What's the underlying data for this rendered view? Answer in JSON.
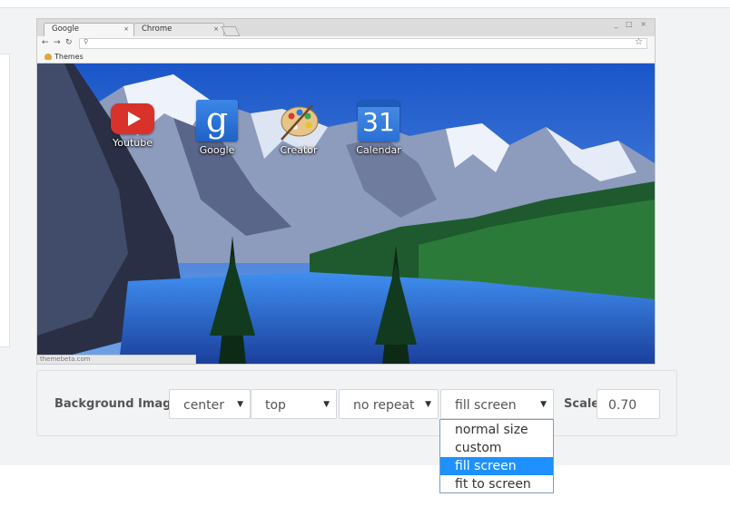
{
  "browser": {
    "tabs": [
      {
        "label": "Google",
        "close": "×",
        "active": true
      },
      {
        "label": "Chrome",
        "close": "×",
        "active": false
      }
    ],
    "window_controls": "_ □ ×",
    "nav": {
      "back": "←",
      "forward": "→",
      "reload": "↻"
    },
    "omnibox": {
      "search_glyph": "⚲",
      "star_glyph": "☆"
    },
    "bookmarks": [
      {
        "label": "Themes"
      }
    ],
    "apps": [
      {
        "label": "Youtube"
      },
      {
        "label": "Google",
        "glyph": "g"
      },
      {
        "label": "Creator"
      },
      {
        "label": "Calendar",
        "glyph": "31"
      }
    ],
    "status_text": "themebeta.com"
  },
  "controls": {
    "background_label": "Background Image:",
    "position_x": "center",
    "position_y": "top",
    "repeat": "no repeat",
    "size": "fill screen",
    "caret": "▼",
    "scale_label": "Scale:",
    "scale_value": "0.70"
  },
  "size_dropdown": {
    "options": [
      "normal size",
      "custom",
      "fill screen",
      "fit to screen"
    ],
    "selected": "fill screen",
    "highlight_color": "#1e90ff"
  }
}
